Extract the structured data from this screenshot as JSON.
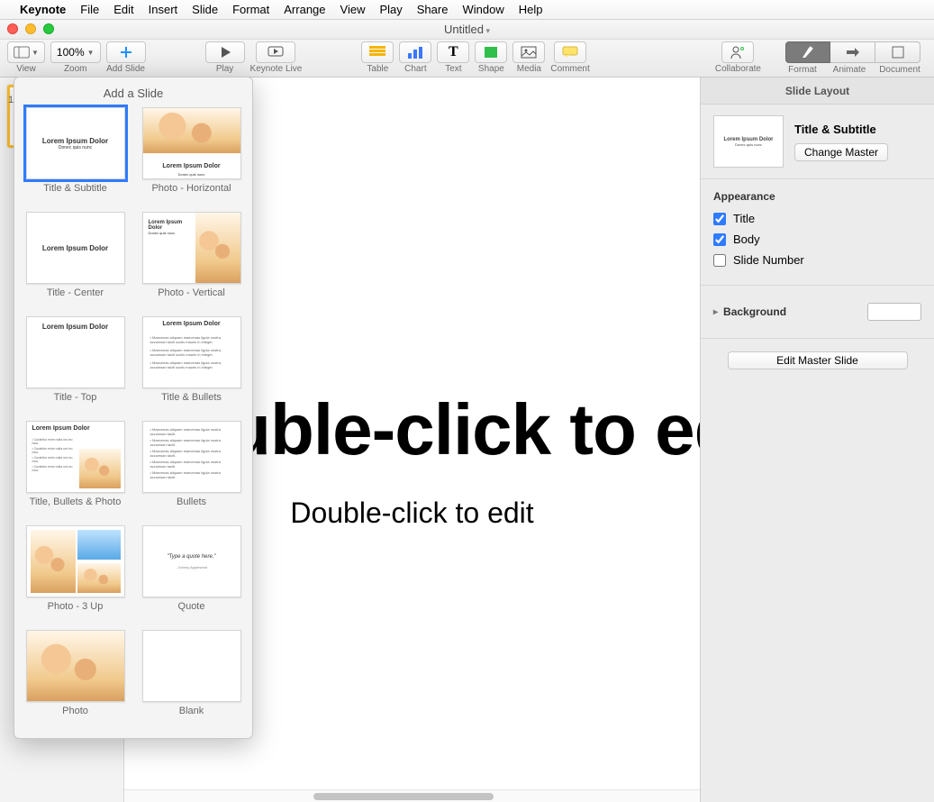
{
  "menubar": {
    "app": "Keynote",
    "items": [
      "File",
      "Edit",
      "Insert",
      "Slide",
      "Format",
      "Arrange",
      "View",
      "Play",
      "Share",
      "Window",
      "Help"
    ]
  },
  "window": {
    "title": "Untitled"
  },
  "toolbar": {
    "view": "View",
    "zoom_label": "Zoom",
    "zoom_value": "100%",
    "add_slide": "Add Slide",
    "play": "Play",
    "keynote_live": "Keynote Live",
    "table": "Table",
    "chart": "Chart",
    "text": "Text",
    "shape": "Shape",
    "media": "Media",
    "comment": "Comment",
    "collaborate": "Collaborate",
    "format": "Format",
    "animate": "Animate",
    "document": "Document"
  },
  "popover": {
    "title": "Add a Slide",
    "items": [
      {
        "label": "Title & Subtitle",
        "selected": true,
        "kind": "title_sub"
      },
      {
        "label": "Photo - Horizontal",
        "kind": "photo_h"
      },
      {
        "label": "Title - Center",
        "kind": "title_center"
      },
      {
        "label": "Photo - Vertical",
        "kind": "photo_v"
      },
      {
        "label": "Title - Top",
        "kind": "title_top"
      },
      {
        "label": "Title & Bullets",
        "kind": "title_bullets"
      },
      {
        "label": "Title, Bullets & Photo",
        "kind": "tbp"
      },
      {
        "label": "Bullets",
        "kind": "bullets"
      },
      {
        "label": "Photo - 3 Up",
        "kind": "p3"
      },
      {
        "label": "Quote",
        "kind": "quote"
      },
      {
        "label": "Photo",
        "kind": "photo"
      },
      {
        "label": "Blank",
        "kind": "blank"
      }
    ],
    "lorem_title": "Lorem Ipsum Dolor",
    "lorem_sub": "Donec quis nunc",
    "quote_text": "\"Type a quote here.\""
  },
  "slide": {
    "title": "Double-click to edit",
    "subtitle": "Double-click to edit"
  },
  "nav": {
    "index": "1"
  },
  "inspector": {
    "header": "Slide Layout",
    "layout_title": "Title & Subtitle",
    "change_master": "Change Master",
    "appearance": "Appearance",
    "chk_title": "Title",
    "chk_body": "Body",
    "chk_slidenum": "Slide Number",
    "background": "Background",
    "edit_master": "Edit Master Slide"
  }
}
